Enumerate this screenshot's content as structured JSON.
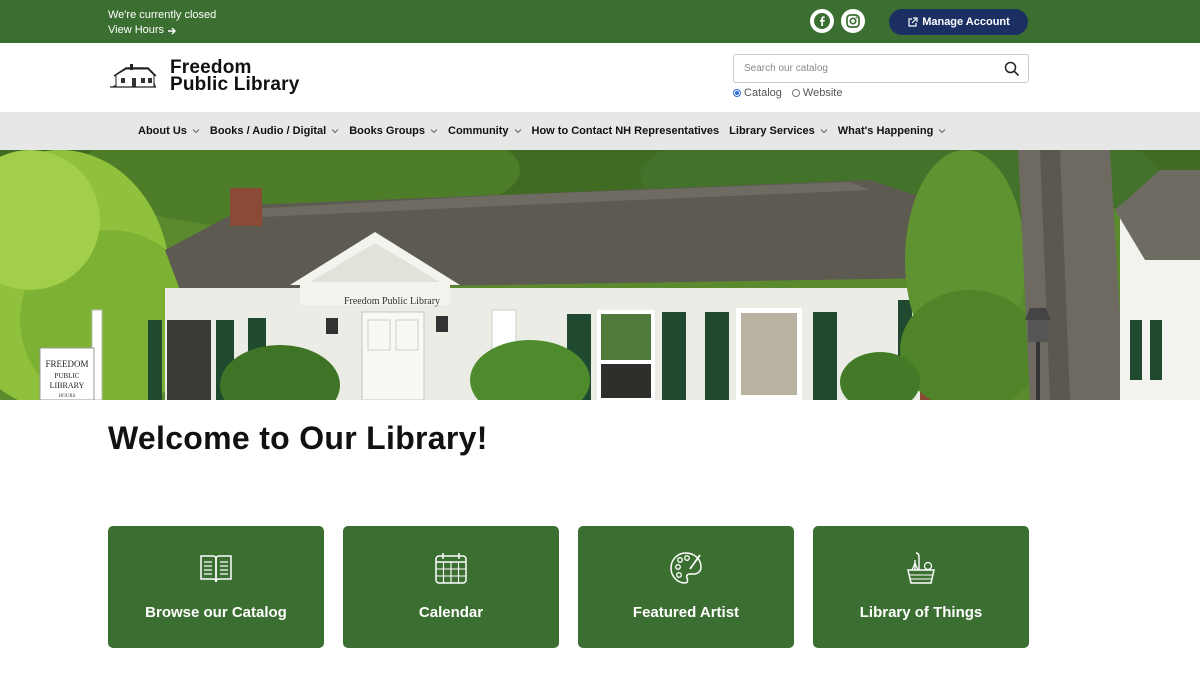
{
  "topbar": {
    "status": "We're currently closed",
    "hours_link": "View Hours",
    "social": [
      {
        "icon": "facebook-icon"
      },
      {
        "icon": "instagram-icon"
      }
    ],
    "manage_account": "Manage Account"
  },
  "header": {
    "logo_line1": "Freedom",
    "logo_line2": "Public Library",
    "search": {
      "placeholder": "Search our catalog",
      "value": "",
      "scopes": [
        {
          "label": "Catalog",
          "selected": true
        },
        {
          "label": "Website",
          "selected": false
        }
      ]
    }
  },
  "nav": {
    "items": [
      {
        "label": "About Us",
        "dropdown": true
      },
      {
        "label": "Books / Audio / Digital",
        "dropdown": true
      },
      {
        "label": "Books Groups",
        "dropdown": true
      },
      {
        "label": "Community",
        "dropdown": true
      },
      {
        "label": "How to Contact NH Representatives",
        "dropdown": false
      },
      {
        "label": "Library Services",
        "dropdown": true
      },
      {
        "label": "What's Happening",
        "dropdown": true
      }
    ]
  },
  "hero": {
    "building_sign": "Freedom Public Library",
    "lawn_sign": [
      "FREEDOM",
      "PUBLIC",
      "LIBRARY",
      "HOURS"
    ]
  },
  "main": {
    "heading": "Welcome to Our Library!",
    "cards": [
      {
        "label": "Browse our Catalog",
        "icon": "open-book-icon"
      },
      {
        "label": "Calendar",
        "icon": "calendar-icon"
      },
      {
        "label": "Featured Artist",
        "icon": "palette-icon"
      },
      {
        "label": "Library of Things",
        "icon": "basket-icon"
      }
    ]
  },
  "colors": {
    "brand_green": "#3b6e31",
    "account_navy": "#1b2f63",
    "nav_gray": "#e7e7e7"
  }
}
